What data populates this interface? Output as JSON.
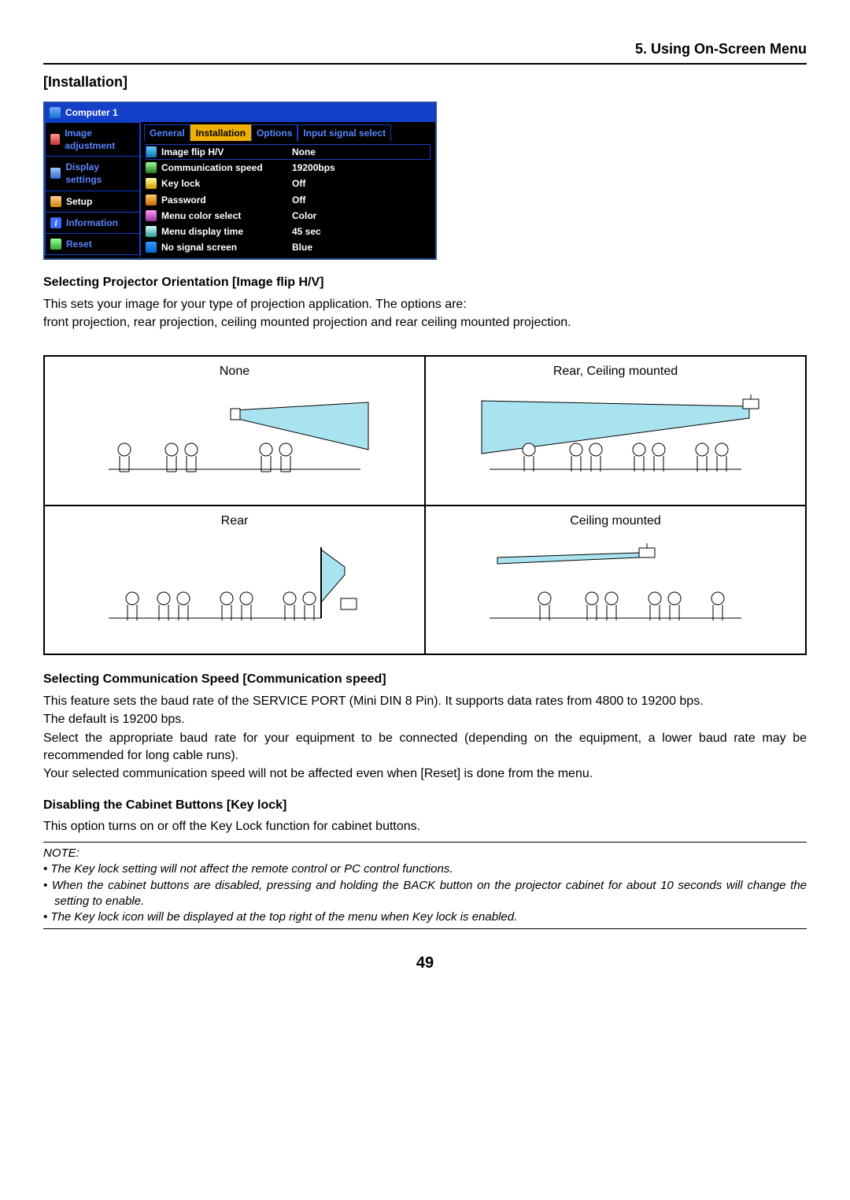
{
  "header": {
    "chapter": "5. Using On-Screen Menu"
  },
  "section": {
    "title": "[Installation]"
  },
  "osd": {
    "title": "Computer 1",
    "left": {
      "items": [
        {
          "label": "Image adjustment",
          "selected": false,
          "iconCls": "ic-img"
        },
        {
          "label": "Display settings",
          "selected": false,
          "iconCls": "ic-disp"
        },
        {
          "label": "Setup",
          "selected": true,
          "iconCls": "ic-setup"
        },
        {
          "label": "Information",
          "selected": false,
          "iconCls": "ic-info",
          "iconText": "i"
        },
        {
          "label": "Reset",
          "selected": false,
          "iconCls": "ic-reset"
        }
      ]
    },
    "tabs": {
      "items": [
        {
          "label": "General",
          "active": false
        },
        {
          "label": "Installation",
          "active": true
        },
        {
          "label": "Options",
          "active": false
        },
        {
          "label": "Input signal select",
          "active": false
        }
      ]
    },
    "settings": {
      "items": [
        {
          "iconCls": "ic-flip",
          "label": "Image flip H/V",
          "value": "None",
          "selected": true
        },
        {
          "iconCls": "ic-comm",
          "label": "Communication speed",
          "value": "19200bps",
          "selected": false
        },
        {
          "iconCls": "ic-key",
          "label": "Key lock",
          "value": "Off",
          "selected": false
        },
        {
          "iconCls": "ic-pw",
          "label": "Password",
          "value": "Off",
          "selected": false
        },
        {
          "iconCls": "ic-col",
          "label": "Menu color select",
          "value": "Color",
          "selected": false
        },
        {
          "iconCls": "ic-time",
          "label": "Menu display time",
          "value": "45 sec",
          "selected": false
        },
        {
          "iconCls": "ic-nos",
          "label": "No signal screen",
          "value": "Blue",
          "selected": false
        }
      ]
    }
  },
  "sub1": {
    "heading": "Selecting Projector Orientation [Image flip H/V]",
    "p1": "This sets your image for your type of projection application. The options are:",
    "p2": "front projection, rear projection, ceiling mounted projection and rear ceiling mounted projection."
  },
  "diagrams": {
    "cells": [
      {
        "label": "None"
      },
      {
        "label": "Rear, Ceiling mounted"
      },
      {
        "label": "Rear"
      },
      {
        "label": "Ceiling mounted"
      }
    ]
  },
  "sub2": {
    "heading": "Selecting Communication Speed [Communication speed]",
    "p1": "This feature sets the baud rate of the SERVICE PORT (Mini DIN 8 Pin). It supports data rates from 4800 to 19200 bps.",
    "p2": "The default is 19200 bps.",
    "p3": "Select the appropriate baud rate for your equipment to be connected (depending on the equipment, a lower baud rate may be recommended for long cable runs).",
    "p4": "Your selected communication speed will not be affected even when [Reset] is done from the menu."
  },
  "sub3": {
    "heading": "Disabling the Cabinet Buttons [Key lock]",
    "p1": "This option turns on or off the Key Lock function for cabinet buttons."
  },
  "note": {
    "title": "NOTE:",
    "items": [
      "The Key lock setting will not affect the remote control or PC control functions.",
      "When the cabinet buttons are disabled, pressing and holding the BACK button on the projector cabinet for about 10 seconds will change the setting to enable.",
      "The Key lock icon will be displayed at the top right of the menu when Key lock is enabled."
    ]
  },
  "pagenum": "49"
}
